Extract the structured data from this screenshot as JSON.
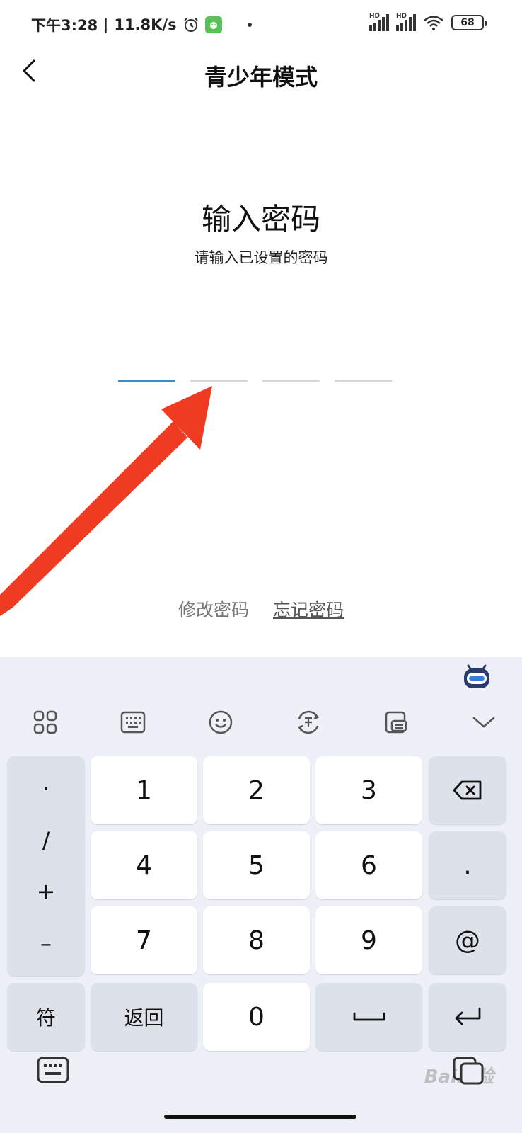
{
  "status_bar": {
    "time": "下午3:28",
    "separator": "|",
    "net_speed": "11.8K/s",
    "battery": "68",
    "hd_label": "HD"
  },
  "header": {
    "title": "青少年模式"
  },
  "password": {
    "title": "输入密码",
    "subtitle": "请输入已设置的密码",
    "slot_count": 4,
    "filled_digits": 0
  },
  "links": {
    "change_password": "修改密码",
    "forgot_password": "忘记密码"
  },
  "keyboard": {
    "symbols": [
      "·",
      "/",
      "+",
      "–"
    ],
    "digits": [
      "1",
      "2",
      "3",
      "4",
      "5",
      "6",
      "7",
      "8",
      "9",
      "0"
    ],
    "right_keys": [
      ".",
      "@"
    ],
    "fu_label": "符",
    "back_label": "返回"
  },
  "watermark": "Bai经验",
  "colors": {
    "active_slot": "#3a8fc7",
    "arrow": "#ee3b22",
    "keyboard_bg": "#edf0f6"
  }
}
